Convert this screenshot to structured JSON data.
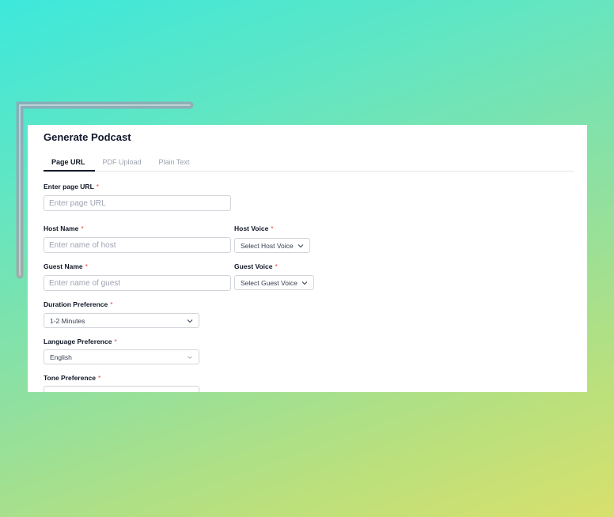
{
  "form": {
    "title": "Generate Podcast",
    "tabs": [
      {
        "label": "Page URL",
        "active": true
      },
      {
        "label": "PDF Upload",
        "active": false
      },
      {
        "label": "Plain Text",
        "active": false
      }
    ],
    "page_url": {
      "label": "Enter page URL",
      "required": "*",
      "placeholder": "Enter page URL",
      "value": ""
    },
    "host_name": {
      "label": "Host Name",
      "required": "*",
      "placeholder": "Enter name of host",
      "value": ""
    },
    "host_voice": {
      "label": "Host Voice",
      "required": "*",
      "selected": "Select Host Voice"
    },
    "guest_name": {
      "label": "Guest Name",
      "required": "*",
      "placeholder": "Enter name of guest",
      "value": ""
    },
    "guest_voice": {
      "label": "Guest Voice",
      "required": "*",
      "selected": "Select Guest Voice"
    },
    "duration": {
      "label": "Duration Preference",
      "required": "*",
      "selected": "1-2 Minutes"
    },
    "language": {
      "label": "Language Preference",
      "required": "*",
      "selected": "English"
    },
    "tone": {
      "label": "Tone Preference",
      "required": "*",
      "selected": ""
    }
  },
  "colors": {
    "accent": "#111827",
    "required": "#ef4444",
    "neon_cyan": "#22d3ee",
    "neon_purple": "#8b5cf6",
    "neon_magenta": "#ec4899"
  }
}
